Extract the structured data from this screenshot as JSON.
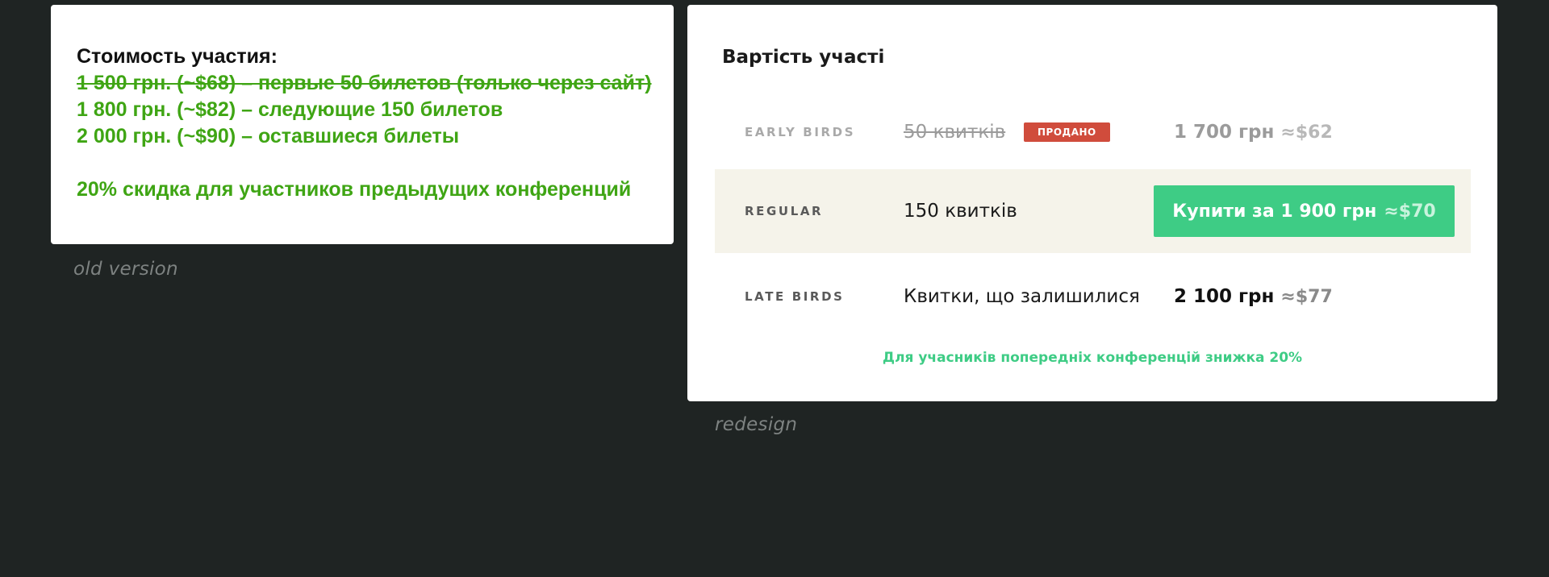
{
  "old_version": {
    "title": "Стоимость участия:",
    "lines": [
      "1 500 грн. (~$68) – первые 50 билетов (только через сайт)",
      "1 800 грн. (~$82) – следующие 150 билетов",
      "2 000 грн. (~$90) – оставшиеся билеты"
    ],
    "discount": "20% скидка для участников предыдущих конференций",
    "caption": "old version"
  },
  "redesign": {
    "title": "Вартість участі",
    "tiers": [
      {
        "name": "EARLY BIRDS",
        "description": "50 квитків",
        "badge": "ПРОДАНО",
        "price": "1 700 грн",
        "usd": "≈$62",
        "status": "sold-out"
      },
      {
        "name": "REGULAR",
        "description": "150 квитків",
        "button_label": "Купити за 1 900 грн",
        "button_usd": "≈$70",
        "status": "active"
      },
      {
        "name": "LATE BIRDS",
        "description": "Квитки, що залишилися",
        "price": "2 100 грн",
        "usd": "≈$77",
        "status": "upcoming"
      }
    ],
    "discount": "Для учасників попередніх конференцій знижка 20%",
    "caption": "redesign"
  },
  "colors": {
    "background": "#1f2423",
    "old_green": "#3fa514",
    "accent_green": "#3ecc85",
    "sold_red": "#d04c3c",
    "highlight_row": "#f5f3ea"
  }
}
